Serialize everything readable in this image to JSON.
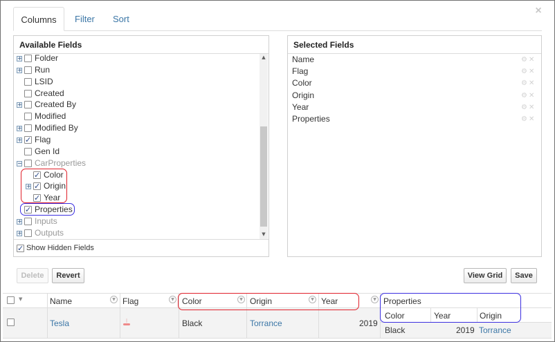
{
  "dialog": {
    "close_glyph": "×",
    "tabs": [
      {
        "label": "Columns",
        "active": true
      },
      {
        "label": "Filter",
        "active": false
      },
      {
        "label": "Sort",
        "active": false
      }
    ]
  },
  "available_fields": {
    "title": "Available Fields",
    "items": [
      {
        "label": "Folder",
        "expander": true,
        "checked": false,
        "indent": 0,
        "gray": false
      },
      {
        "label": "Run",
        "expander": true,
        "checked": false,
        "indent": 0,
        "gray": false
      },
      {
        "label": "LSID",
        "expander": false,
        "checked": false,
        "indent": 0,
        "gray": false
      },
      {
        "label": "Created",
        "expander": false,
        "checked": false,
        "indent": 0,
        "gray": false
      },
      {
        "label": "Created By",
        "expander": true,
        "checked": false,
        "indent": 0,
        "gray": false
      },
      {
        "label": "Modified",
        "expander": false,
        "checked": false,
        "indent": 0,
        "gray": false
      },
      {
        "label": "Modified By",
        "expander": true,
        "checked": false,
        "indent": 0,
        "gray": false
      },
      {
        "label": "Flag",
        "expander": true,
        "checked": true,
        "indent": 0,
        "gray": false
      },
      {
        "label": "Gen Id",
        "expander": false,
        "checked": false,
        "indent": 0,
        "gray": false
      },
      {
        "label": "CarProperties",
        "expander": true,
        "expanded": true,
        "checked": false,
        "indent": 0,
        "gray": true
      },
      {
        "label": "Color",
        "expander": false,
        "checked": true,
        "indent": 1,
        "gray": false
      },
      {
        "label": "Origin",
        "expander": true,
        "checked": true,
        "indent": 1,
        "gray": false
      },
      {
        "label": "Year",
        "expander": false,
        "checked": true,
        "indent": 1,
        "gray": false
      },
      {
        "label": "Properties",
        "expander": false,
        "checked": true,
        "indent": 0,
        "gray": false
      },
      {
        "label": "Inputs",
        "expander": true,
        "checked": false,
        "indent": 0,
        "gray": true
      },
      {
        "label": "Outputs",
        "expander": true,
        "checked": false,
        "indent": 0,
        "gray": true
      }
    ],
    "show_hidden_label": "Show Hidden Fields",
    "show_hidden_checked": true
  },
  "selected_fields": {
    "title": "Selected Fields",
    "items": [
      "Name",
      "Flag",
      "Color",
      "Origin",
      "Year",
      "Properties"
    ]
  },
  "buttons": {
    "delete": "Delete",
    "revert": "Revert",
    "view_grid": "View Grid",
    "save": "Save"
  },
  "grid": {
    "headers": {
      "name": "Name",
      "flag": "Flag",
      "color": "Color",
      "origin": "Origin",
      "year": "Year",
      "properties": "Properties"
    },
    "sub_headers": [
      "Color",
      "Year",
      "Origin"
    ],
    "row": {
      "name": "Tesla",
      "color": "Black",
      "origin": "Torrance",
      "year": "2019",
      "properties": {
        "color": "Black",
        "year": "2019",
        "origin": "Torrance"
      }
    }
  },
  "colors": {
    "link": "#3b76a6",
    "highlight_red": "#e0202a",
    "highlight_blue": "#3a2ee0"
  }
}
